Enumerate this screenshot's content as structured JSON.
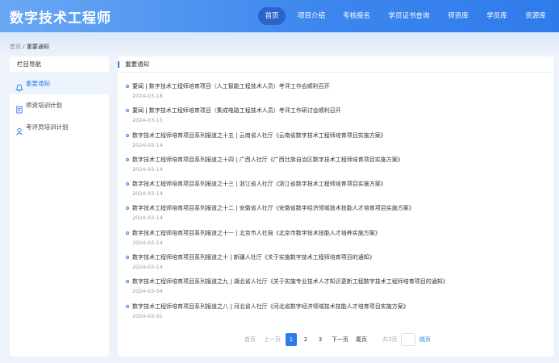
{
  "header": {
    "site_title": "数字技术工程师",
    "nav": [
      "首页",
      "项目介绍",
      "考核报名",
      "学员证书查询",
      "师资库",
      "学员库",
      "资源库"
    ],
    "active_nav": 0
  },
  "breadcrumb": {
    "home": "首页",
    "separator": "/",
    "current": "重要通知"
  },
  "sidebar": {
    "title": "栏目导航",
    "items": [
      {
        "label": "重要通知",
        "icon": "bell-icon",
        "active": true
      },
      {
        "label": "师资培训计划",
        "icon": "document-icon",
        "active": false
      },
      {
        "label": "考评员培训计划",
        "icon": "user-icon",
        "active": false
      }
    ]
  },
  "main": {
    "title": "重要通知",
    "news": [
      {
        "title": "要闻 | 数字技术工程师培育项目（人工智能工程技术人员）考评工作会顺利召开",
        "date": "2024-03-18"
      },
      {
        "title": "要闻 | 数字技术工程师培育项目（集成电路工程技术人员）考评工作研讨会顺利召开",
        "date": "2024-03-15"
      },
      {
        "title": "数字技术工程师培育项目系列报道之十五 | 云南省人社厅《云南省数字技术工程师培育项目实施方案》",
        "date": "2024-03-14"
      },
      {
        "title": "数字技术工程师培育项目系列报道之十四 | 广西人社厅《广西壮族自治区数字技术工程师培育项目实施方案》",
        "date": "2024-03-14"
      },
      {
        "title": "数字技术工程师培育项目系列报道之十三 | 浙江省人社厅《浙江省数字技术工程师培育项目实施方案》",
        "date": "2024-03-14"
      },
      {
        "title": "数字技术工程师培育项目系列报道之十二 | 安徽省人社厅《安徽省数字经济领域技术技能人才培育项目实施方案》",
        "date": "2024-03-14"
      },
      {
        "title": "数字技术工程师培育项目系列报道之十一 | 北京市人社局《北京市数字技术技能人才培养实施方案》",
        "date": "2024-03-14"
      },
      {
        "title": "数字技术工程师培育项目系列报道之十 | 新疆人社厅《关于实施数字技术工程师培育项目的通知》",
        "date": "2024-03-14"
      },
      {
        "title": "数字技术工程师培育项目系列报道之九 | 湖北省人社厅《关于实施专业技术人才知识更新工程数字技术工程师培育项目的通知》",
        "date": "2024-03-04"
      },
      {
        "title": "数字技术工程师培育项目系列报道之八 | 河北省人社厅《河北省数字经济领域技术技能人才培育项目实施方案》",
        "date": "2024-03-01"
      }
    ]
  },
  "pager": {
    "first": "首页",
    "prev": "上一页",
    "pages": [
      "1",
      "2",
      "3"
    ],
    "current_page": 1,
    "next": "下一页",
    "last": "尾页",
    "total": "共3页",
    "jump": "跳页"
  },
  "colors": {
    "accent": "#2f7bea",
    "nav_active": "#2a63c9",
    "page_bg": "#eef3fb"
  }
}
